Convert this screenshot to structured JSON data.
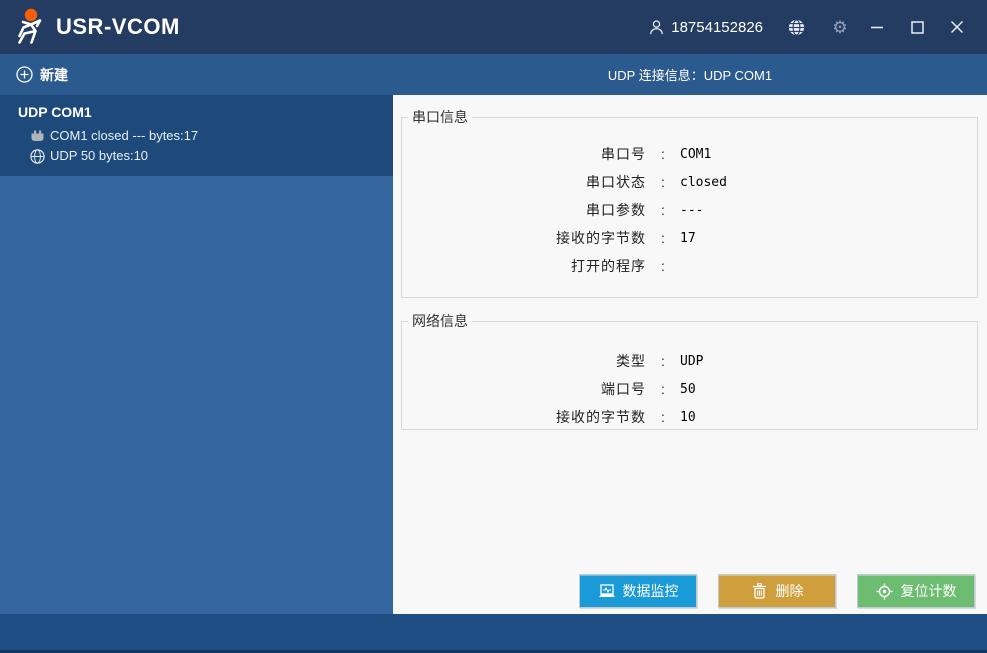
{
  "titlebar": {
    "app_title": "USR-VCOM",
    "user_phone": "18754152826"
  },
  "navbar": {
    "new_label": "新建",
    "connection_info": "UDP 连接信息：UDP COM1"
  },
  "sidebar": {
    "selected_item": {
      "title": "UDP COM1",
      "serial_status": "COM1 closed --- bytes:17",
      "network_status": "UDP 50 bytes:10"
    }
  },
  "separator": ":",
  "serial_section": {
    "title": "串口信息",
    "rows": [
      {
        "label": "串口号",
        "value": "COM1"
      },
      {
        "label": "串口状态",
        "value": "closed"
      },
      {
        "label": "串口参数",
        "value": "---"
      },
      {
        "label": "接收的字节数",
        "value": "17"
      },
      {
        "label": "打开的程序",
        "value": ""
      }
    ]
  },
  "network_section": {
    "title": "网络信息",
    "rows": [
      {
        "label": "类型",
        "value": "UDP"
      },
      {
        "label": "端口号",
        "value": "50"
      },
      {
        "label": "接收的字节数",
        "value": "10"
      }
    ]
  },
  "buttons": {
    "monitor": "数据监控",
    "delete": "删除",
    "reset": "复位计数"
  },
  "icons": {
    "logo": "usr-running-man",
    "user": "person-outline",
    "language": "globe",
    "settings": "gear",
    "window": [
      "minimize",
      "maximize",
      "close"
    ],
    "new": "circle-plus",
    "serial_row": "serial-connector",
    "network_row": "globe",
    "monitor_btn": "laptop-pulse",
    "delete_btn": "trash",
    "reset_btn": "crosshair-target"
  },
  "colors": {
    "titlebar_bg": "#243b62",
    "navbar_bg": "#2b5a8e",
    "sidebar_bg": "#34659e",
    "selected_item_bg": "#1d4a7b",
    "bottombar_bg": "#1f4e85",
    "logo_head": "#f95f06",
    "monitor_btn_bg": "#1b9ad8",
    "delete_btn_bg": "#cf9f3d",
    "reset_btn_bg": "#6cbd72",
    "main_bg": "#f8f8f8"
  }
}
